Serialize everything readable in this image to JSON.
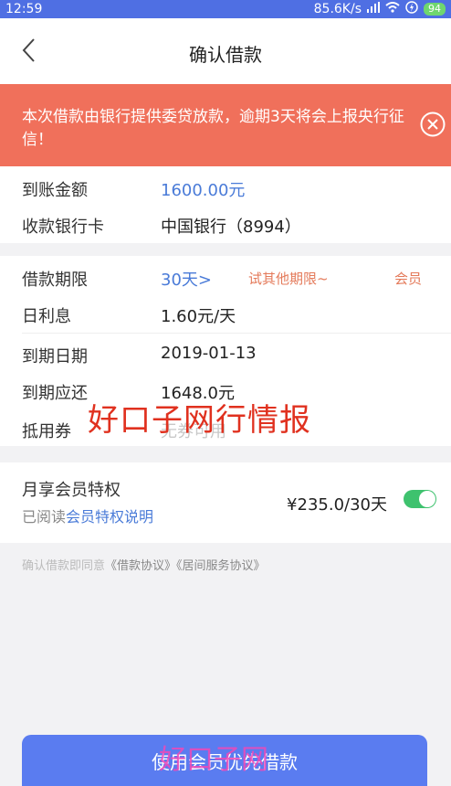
{
  "status_bar": {
    "time": "12:59",
    "speed": "85.6K/s",
    "battery": "94"
  },
  "header": {
    "title": "确认借款"
  },
  "alert": {
    "text": "本次借款由银行提供委贷放款，逾期3天将会上报央行征信！"
  },
  "receive": {
    "amount_label": "到账金额",
    "amount_value": "1600.00元",
    "card_label": "收款银行卡",
    "card_value": "中国银行（8994）"
  },
  "loan": {
    "term_label": "借款期限",
    "term_value": "30天>",
    "term_hint": "试其他期限~",
    "member_hint": "会员",
    "interest_label": "日利息",
    "interest_value": "1.60元/天",
    "due_date_label": "到期日期",
    "due_date_value": "2019-01-13",
    "repay_label": "到期应还",
    "repay_value": "1648.0元",
    "coupon_label": "抵用券",
    "coupon_value": "无券可用"
  },
  "watermark": "好口子网行情报",
  "membership": {
    "title": "月享会员特权",
    "read_prefix": "已阅读",
    "read_link": "会员特权说明",
    "price": "¥235.0/30天",
    "enabled": true
  },
  "agreement": {
    "prefix": "确认借款即同意",
    "doc1": "《借款协议》",
    "doc2": "《居间服务协议》"
  },
  "submit_button": {
    "label": "使用会员优先借款",
    "logo_text": "好口子网"
  },
  "colors": {
    "status_bar": "#4f6fe3",
    "alert": "#f0705b",
    "accent": "#4a7bd8",
    "button": "#5a7cf0",
    "toggle_on": "#3ec26e"
  }
}
